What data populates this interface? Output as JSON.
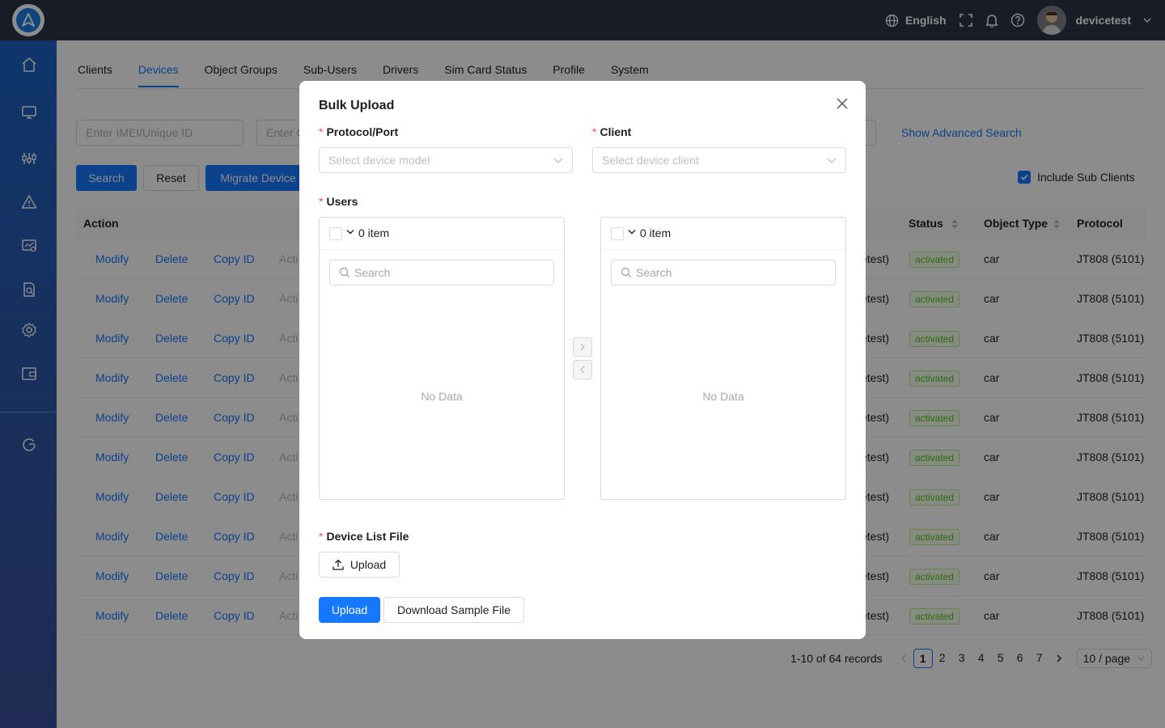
{
  "topbar": {
    "language": "English",
    "username": "devicetest",
    "icons": [
      "globe-icon",
      "fullscreen-icon",
      "bell-icon",
      "help-icon",
      "chevron-down-icon"
    ]
  },
  "sidebar": {
    "items": [
      "home-icon",
      "monitor-icon",
      "sliders-icon",
      "alert-icon",
      "dashboard-icon",
      "report-icon",
      "settings-icon",
      "wallet-icon",
      "logout-icon"
    ]
  },
  "tabs": [
    "Clients",
    "Devices",
    "Object Groups",
    "Sub-Users",
    "Drivers",
    "Sim Card Status",
    "Profile",
    "System"
  ],
  "active_tab": "Devices",
  "filters": {
    "imei_placeholder": "Enter IMEI/Unique ID",
    "second_placeholder": "Enter C",
    "show_advanced": "Show Advanced Search",
    "include_sub_clients": "Include Sub Clients"
  },
  "buttons": {
    "search": "Search",
    "reset": "Reset",
    "migrate": "Migrate Device"
  },
  "table": {
    "headers": {
      "action": "Action",
      "status": "Status",
      "object_type": "Object Type",
      "protocol": "Protocol"
    },
    "row_actions": {
      "modify": "Modify",
      "delete": "Delete",
      "copy_id": "Copy ID",
      "partial": "Acti"
    },
    "rows": [
      {
        "client": "etest)",
        "status": "activated",
        "object_type": "car",
        "protocol": "JT808 (5101)"
      },
      {
        "client": "etest)",
        "status": "activated",
        "object_type": "car",
        "protocol": "JT808 (5101)"
      },
      {
        "client": "etest)",
        "status": "activated",
        "object_type": "car",
        "protocol": "JT808 (5101)"
      },
      {
        "client": "etest)",
        "status": "activated",
        "object_type": "car",
        "protocol": "JT808 (5101)"
      },
      {
        "client": "etest)",
        "status": "activated",
        "object_type": "car",
        "protocol": "JT808 (5101)"
      },
      {
        "client": "etest)",
        "status": "activated",
        "object_type": "car",
        "protocol": "JT808 (5101)"
      },
      {
        "client": "etest)",
        "status": "activated",
        "object_type": "car",
        "protocol": "JT808 (5101)"
      },
      {
        "client": "etest)",
        "status": "activated",
        "object_type": "car",
        "protocol": "JT808 (5101)"
      },
      {
        "client": "etest)",
        "status": "activated",
        "object_type": "car",
        "protocol": "JT808 (5101)"
      },
      {
        "client": "etest)",
        "status": "activated",
        "object_type": "car",
        "protocol": "JT808 (5101)"
      }
    ]
  },
  "pagination": {
    "summary": "1-10 of 64 records",
    "pages": [
      "1",
      "2",
      "3",
      "4",
      "5",
      "6",
      "7"
    ],
    "current": "1",
    "page_size": "10 / page"
  },
  "modal": {
    "title": "Bulk Upload",
    "protocol_label": "Protocol/Port",
    "protocol_placeholder": "Select device model",
    "client_label": "Client",
    "client_placeholder": "Select device client",
    "users_label": "Users",
    "transfer_left": {
      "count": "0 item",
      "search_placeholder": "Search",
      "empty": "No Data"
    },
    "transfer_right": {
      "count": "0 item",
      "search_placeholder": "Search",
      "empty": "No Data"
    },
    "file_label": "Device List File",
    "upload_file_button": "Upload",
    "upload_button": "Upload",
    "download_sample_button": "Download Sample File",
    "required_mark": "*"
  },
  "colors": {
    "primary": "#1677ff",
    "topbar": "#2b3446",
    "sidebar": "#1c62c4",
    "status_activated": "#52c41a"
  }
}
